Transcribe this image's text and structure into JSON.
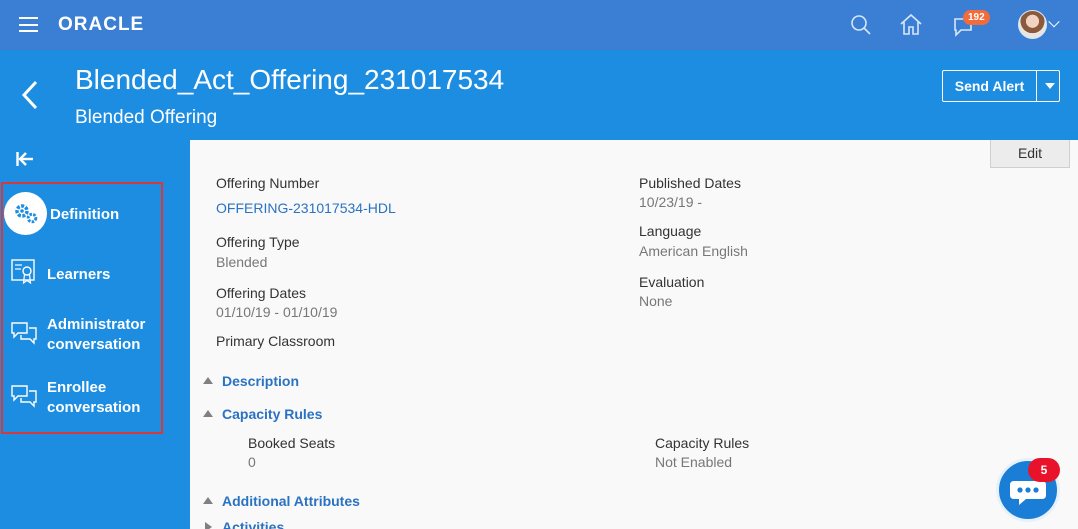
{
  "topbar": {
    "logo": "ORACLE",
    "notification_count": "192",
    "icons": [
      "menu-icon",
      "search-icon",
      "home-icon",
      "notifications-icon",
      "avatar"
    ]
  },
  "header": {
    "title": "Blended_Act_Offering_231017534",
    "subtitle": "Blended Offering",
    "send_alert_label": "Send Alert"
  },
  "sidebar": {
    "items": [
      {
        "label": "Definition",
        "icon": "gears-icon",
        "selected": true
      },
      {
        "label": "Learners",
        "icon": "learner-certificate-icon"
      },
      {
        "label_line1": "Administrator",
        "label_line2": "conversation",
        "icon": "chat-bubbles-icon"
      },
      {
        "label_line1": "Enrollee",
        "label_line2": "conversation",
        "icon": "chat-bubbles-icon"
      }
    ]
  },
  "content": {
    "edit_label": "Edit",
    "left_fields": [
      {
        "label": "Offering Number",
        "value": "OFFERING-231017534-HDL"
      },
      {
        "label": "Offering Type",
        "value": "Blended"
      },
      {
        "label": "Offering Dates",
        "value": "01/10/19 - 01/10/19"
      },
      {
        "label": "Primary Classroom",
        "value": ""
      }
    ],
    "right_fields": [
      {
        "label": "Published Dates",
        "value": "10/23/19 -"
      },
      {
        "label": "Language",
        "value": "American English"
      },
      {
        "label": "Evaluation",
        "value": "None"
      }
    ],
    "sections": [
      {
        "label": "Description",
        "expanded": true
      },
      {
        "label": "Capacity Rules",
        "expanded": true
      },
      {
        "label": "Additional Attributes",
        "expanded": true
      },
      {
        "label": "Activities",
        "expanded": false
      }
    ],
    "capacity": {
      "booked_label": "Booked Seats",
      "booked_value": "0",
      "rules_label": "Capacity Rules",
      "rules_value": "Not Enabled"
    }
  },
  "chat": {
    "badge": "5"
  },
  "colors": {
    "topbar": "#3b7fd4",
    "header": "#1d8de2",
    "link": "#2a72c2",
    "badge": "#f26b3a",
    "chat_badge": "#e8132a"
  }
}
